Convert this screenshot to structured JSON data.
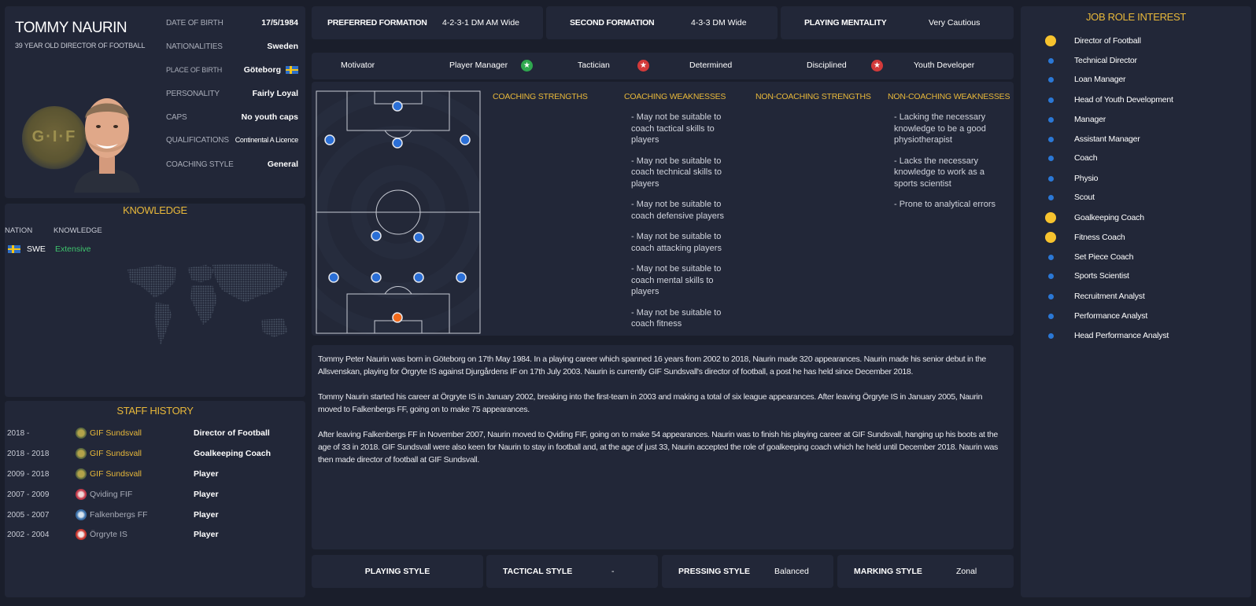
{
  "profile": {
    "name": "TOMMY NAURIN",
    "subtitle": "39 YEAR OLD DIRECTOR OF FOOTBALL",
    "badge_text": "G·I·F",
    "rows": [
      {
        "label": "DATE OF BIRTH",
        "value": "17/5/1984"
      },
      {
        "label": "NATIONALITIES",
        "value": "Sweden"
      },
      {
        "label": "PLACE OF BIRTH",
        "value": "Göteborg"
      },
      {
        "label": "PERSONALITY",
        "value": "Fairly Loyal"
      },
      {
        "label": "CAPS",
        "value": "No youth caps"
      },
      {
        "label": "QUALIFICATIONS",
        "value": "Continental A Licence"
      },
      {
        "label": "COACHING STYLE",
        "value": "General"
      }
    ]
  },
  "knowledge": {
    "title": "KNOWLEDGE",
    "col_nation": "NATION",
    "col_knowledge": "KNOWLEDGE",
    "nation": "SWE",
    "level": "Extensive"
  },
  "history": {
    "title": "STAFF HISTORY",
    "rows": [
      {
        "years": "2018 -",
        "club": "GIF Sundsvall",
        "role": "Director of Football",
        "highlight": true
      },
      {
        "years": "2018 - 2018",
        "club": "GIF Sundsvall",
        "role": "Goalkeeping Coach",
        "highlight": true
      },
      {
        "years": "2009 - 2018",
        "club": "GIF Sundsvall",
        "role": "Player",
        "highlight": true
      },
      {
        "years": "2007 - 2009",
        "club": "Qviding FIF",
        "role": "Player",
        "highlight": false
      },
      {
        "years": "2005 - 2007",
        "club": "Falkenbergs FF",
        "role": "Player",
        "highlight": false
      },
      {
        "years": "2002 - 2004",
        "club": "Örgryte IS",
        "role": "Player",
        "highlight": false
      }
    ]
  },
  "top": {
    "preferred_label": "PREFERRED FORMATION",
    "preferred_value": "4-2-3-1 DM AM Wide",
    "second_label": "SECOND FORMATION",
    "second_value": "4-3-3 DM Wide",
    "mentality_label": "PLAYING MENTALITY",
    "mentality_value": "Very Cautious"
  },
  "attributes": {
    "motivator": "Motivator",
    "player_manager": "Player Manager",
    "tactician": "Tactician",
    "determined": "Determined",
    "disciplined": "Disciplined",
    "youth_developer": "Youth Developer"
  },
  "strengths": {
    "coaching_strengths": "COACHING STRENGTHS",
    "coaching_weaknesses": "COACHING WEAKNESSES",
    "noncoaching_strengths": "NON-COACHING STRENGTHS",
    "noncoaching_weaknesses": "NON-COACHING WEAKNESSES",
    "cw_items": [
      "- May not be suitable to coach tactical skills to players",
      "- May not be suitable to coach technical skills to players",
      "- May not be suitable to coach defensive players",
      "- May not be suitable to coach attacking players",
      "- May not be suitable to coach mental skills to players",
      "- May not be suitable to coach fitness"
    ],
    "ncw_items": [
      "- Lacking the necessary knowledge to be a good physiotherapist",
      "- Lacks the necessary knowledge to work as a sports scientist",
      "- Prone to analytical errors"
    ]
  },
  "bio": {
    "p1": "Tommy Peter Naurin was born in Göteborg on 17th May 1984. In a playing career which spanned 16 years from 2002 to 2018, Naurin made 320 appearances. Naurin made his senior debut in the Allsvenskan, playing for Örgryte IS against Djurgårdens IF on 17th July 2003. Naurin is currently GIF Sundsvall's director of football, a post he has held since December 2018.",
    "p2": "Tommy Naurin started his career at Örgryte IS in January 2002, breaking into the first-team in 2003 and making a total of six league appearances. After leaving Örgryte IS in January 2005, Naurin moved to Falkenbergs FF, going on to make 75 appearances.",
    "p3": "After leaving Falkenbergs FF in November 2007, Naurin moved to Qviding FIF, going on to make 54 appearances. Naurin was to finish his playing career at GIF Sundsvall, hanging up his boots at the age of 33 in 2018. GIF Sundsvall were also keen for Naurin to stay in football and, at the age of just 33, Naurin accepted the role of goalkeeping coach which he held until December 2018. Naurin was then made director of football at GIF Sundsvall."
  },
  "bottom": {
    "playing_style_label": "PLAYING STYLE",
    "playing_style_value": "",
    "tactical_style_label": "TACTICAL STYLE",
    "tactical_style_value": "-",
    "pressing_style_label": "PRESSING STYLE",
    "pressing_style_value": "Balanced",
    "marking_style_label": "MARKING STYLE",
    "marking_style_value": "Zonal"
  },
  "jobs": {
    "title": "JOB ROLE INTEREST",
    "items": [
      {
        "label": "Director of Football",
        "high": true
      },
      {
        "label": "Technical Director",
        "high": false
      },
      {
        "label": "Loan Manager",
        "high": false
      },
      {
        "label": "Head of Youth Development",
        "high": false
      },
      {
        "label": "Manager",
        "high": false
      },
      {
        "label": "Assistant Manager",
        "high": false
      },
      {
        "label": "Coach",
        "high": false
      },
      {
        "label": "Physio",
        "high": false
      },
      {
        "label": "Scout",
        "high": false
      },
      {
        "label": "Goalkeeping Coach",
        "high": true
      },
      {
        "label": "Fitness Coach",
        "high": true
      },
      {
        "label": "Set Piece Coach",
        "high": false
      },
      {
        "label": "Sports Scientist",
        "high": false
      },
      {
        "label": "Recruitment Analyst",
        "high": false
      },
      {
        "label": "Performance Analyst",
        "high": false
      },
      {
        "label": "Head Performance Analyst",
        "high": false
      }
    ]
  },
  "colors": {
    "accent": "#e8b83a",
    "panel": "#222738",
    "background": "#1a1e2b",
    "good": "#3ec46d",
    "dot_blue": "#2b78d6",
    "dot_yellow": "#f7c32e"
  }
}
